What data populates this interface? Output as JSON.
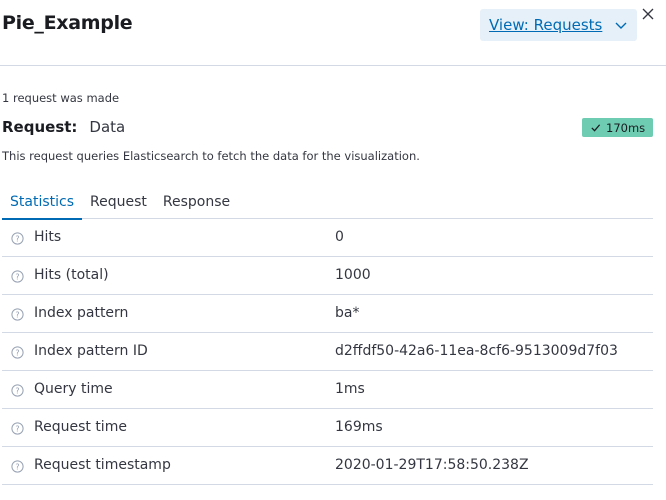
{
  "flyout": {
    "title": "Pie_Example",
    "view_selector_label": "View: Requests"
  },
  "request": {
    "count_text": "1 request was made",
    "label": "Request:",
    "name": "Data",
    "duration_badge": "170ms",
    "badge_color": "#6dccb1",
    "description": "This request queries Elasticsearch to fetch the data for the visualization."
  },
  "tabs": [
    {
      "label": "Statistics",
      "selected": true
    },
    {
      "label": "Request",
      "selected": false
    },
    {
      "label": "Response",
      "selected": false
    }
  ],
  "statistics": [
    {
      "name": "Hits",
      "value": "0"
    },
    {
      "name": "Hits (total)",
      "value": "1000"
    },
    {
      "name": "Index pattern",
      "value": "ba*"
    },
    {
      "name": "Index pattern ID",
      "value": "d2ffdf50-42a6-11ea-8cf6-9513009d7f03"
    },
    {
      "name": "Query time",
      "value": "1ms"
    },
    {
      "name": "Request time",
      "value": "169ms"
    },
    {
      "name": "Request timestamp",
      "value": "2020-01-29T17:58:50.238Z"
    }
  ],
  "icons": {
    "close": "close-icon",
    "dropdown": "chevron-down-icon",
    "check": "check-icon",
    "info": "question-circle-icon"
  },
  "colors": {
    "accent": "#006bb4",
    "border": "#d3dae6",
    "button_bg": "#e6f0f8"
  }
}
